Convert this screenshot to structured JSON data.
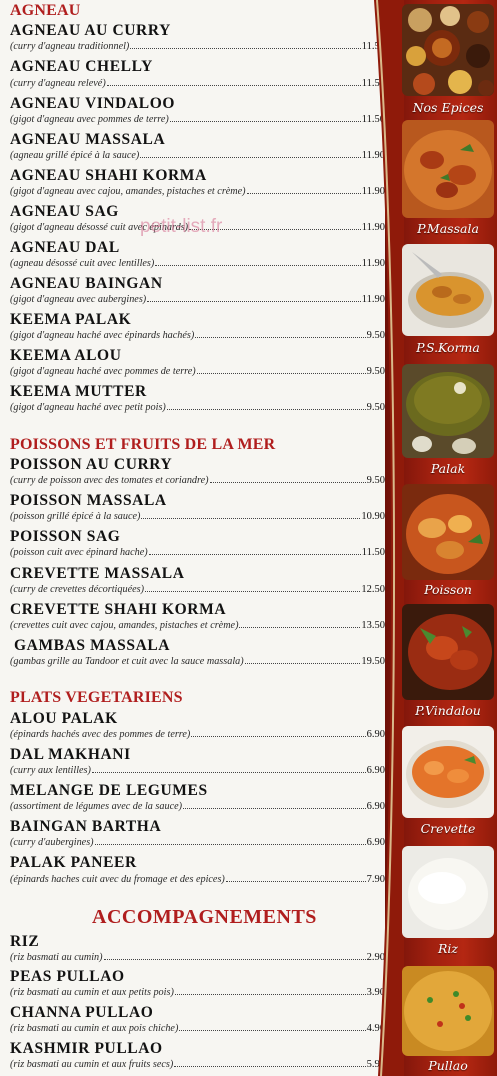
{
  "sections": [
    {
      "title": "AGNEAU",
      "items": [
        {
          "name": "AGNEAU AU CURRY",
          "desc": "(curry d'agneau traditionnel)",
          "price": "11.50"
        },
        {
          "name": "AGNEAU CHELLY",
          "desc": "(curry d'agneau relevé)",
          "price": "11.50"
        },
        {
          "name": "AGNEAU VINDALOO",
          "desc": "(gigot d'agneau avec pommes de terre)",
          "price": "11.50"
        },
        {
          "name": "AGNEAU MASSALA",
          "desc": "(agneau grillé épicé à la sauce)",
          "price": "11.90"
        },
        {
          "name": "AGNEAU SHAHI KORMA",
          "desc": "(gigot d'agneau avec cajou, amandes, pistaches et crème)",
          "price": "11.90"
        },
        {
          "name": "AGNEAU SAG",
          "desc": "(gigot d'agneau désossé cuit avec épinards)",
          "price": "11.90"
        },
        {
          "name": "AGNEAU DAL",
          "desc": "(agneau désossé cuit avec lentilles)",
          "price": "11.90"
        },
        {
          "name": "AGNEAU BAINGAN",
          "desc": "(gigot d'agneau avec aubergines)",
          "price": "11.90"
        },
        {
          "name": "KEEMA PALAK",
          "desc": "(gigot d'agneau haché avec épinards hachés)",
          "price": "9.50"
        },
        {
          "name": "KEEMA ALOU",
          "desc": "(gigot d'agneau haché avec pommes de terre)",
          "price": "9.50"
        },
        {
          "name": "KEEMA MUTTER",
          "desc": "(gigot d'agneau haché avec petit pois)",
          "price": "9.50"
        }
      ]
    },
    {
      "title": "POISSONS ET FRUITS DE LA MER",
      "items": [
        {
          "name": "POISSON AU CURRY",
          "desc": "(curry de poisson avec des tomates et coriandre)",
          "price": "9.50"
        },
        {
          "name": "POISSON MASSALA",
          "desc": "(poisson grillé épicé à la sauce)",
          "price": "10.90"
        },
        {
          "name": "POISSON SAG",
          "desc": "(poisson cuit avec épinard hache)",
          "price": "11.50"
        },
        {
          "name": "CREVETTE MASSALA",
          "desc": "(curry de crevettes décortiquées)",
          "price": "12.50"
        },
        {
          "name": "CREVETTE SHAHI KORMA",
          "desc": "(crevettes cuit avec cajou, amandes, pistaches et crème)",
          "price": "13.50"
        },
        {
          "name": "GAMBAS MASSALA",
          "desc": "(gambas grille au Tandoor et cuit avec la sauce massala)",
          "price": "19.50"
        }
      ]
    },
    {
      "title": "PLATS VEGETARIENS",
      "items": [
        {
          "name": "ALOU PALAK",
          "desc": "(épinards hachés avec des pommes de terre)",
          "price": "6.90"
        },
        {
          "name": "DAL MAKHANI",
          "desc": "(curry aux lentilles)",
          "price": "6.90"
        },
        {
          "name": "MELANGE DE LEGUMES",
          "desc": "(assortiment de légumes avec de la sauce)",
          "price": "6.90"
        },
        {
          "name": "BAINGAN BARTHA",
          "desc": "(curry d'aubergines)",
          "price": "6.90"
        },
        {
          "name": "PALAK PANEER",
          "desc": "(épinards haches cuit avec du fromage et des epices)",
          "price": "7.90"
        }
      ]
    },
    {
      "title": "ACCOMPAGNEMENTS",
      "items": [
        {
          "name": "RIZ",
          "desc": "(riz basmati au cumin)",
          "price": "2.90"
        },
        {
          "name": "PEAS PULLAO",
          "desc": "(riz basmati au cumin et aux petits pois)",
          "price": "3.90"
        },
        {
          "name": "CHANNA PULLAO",
          "desc": "(riz basmati au cumin et aux pois chiche)",
          "price": "4.90"
        },
        {
          "name": "KASHMIR PULLAO",
          "desc": "(riz basmati au cumin et aux fruits secs)",
          "price": "5.90"
        }
      ]
    }
  ],
  "watermark": "petit-list.fr",
  "captions": [
    "Nos Epices",
    "P.Massala",
    "P.S.Korma",
    "Palak",
    "Poisson",
    "P.Vindalou",
    "Crevette",
    "Riz",
    "Pullao"
  ],
  "colors": {
    "section_title": "#b01e1e",
    "band": "#a0200f",
    "text": "#121212"
  }
}
